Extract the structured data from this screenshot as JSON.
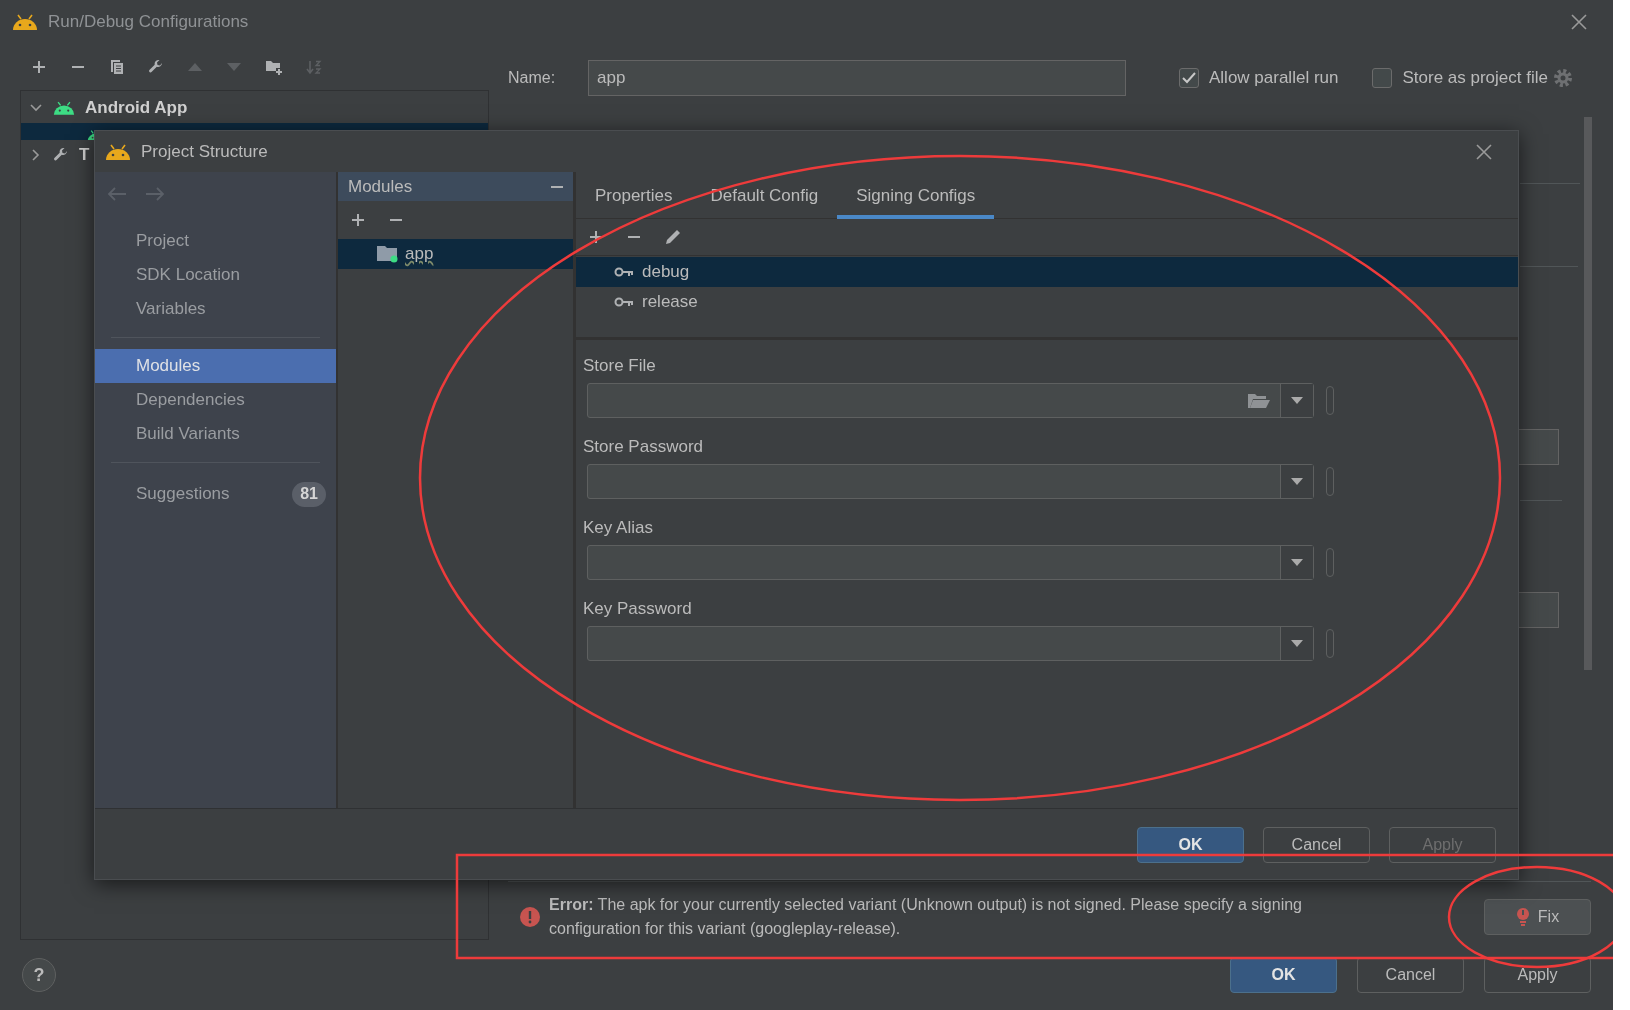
{
  "window": {
    "title": "Run/Debug Configurations"
  },
  "toolbar": [
    {
      "kind": "add",
      "disabled": false
    },
    {
      "kind": "remove",
      "disabled": false
    },
    {
      "kind": "copy",
      "disabled": false
    },
    {
      "kind": "wrench",
      "disabled": false
    },
    {
      "kind": "up",
      "disabled": true
    },
    {
      "kind": "down",
      "disabled": true
    },
    {
      "kind": "folder",
      "disabled": false
    },
    {
      "kind": "sort",
      "disabled": true
    }
  ],
  "tree": [
    {
      "label": "Android App",
      "kind": "android",
      "expanded": true,
      "children": [
        {
          "kind": "android",
          "selected": true
        }
      ]
    },
    {
      "label": "T",
      "kind": "wrench",
      "expanded": false
    }
  ],
  "name_field": {
    "label": "Name:",
    "value": "app"
  },
  "options": [
    {
      "label": "Allow parallel run",
      "checked": true
    },
    {
      "label": "Store as project file",
      "checked": false
    }
  ],
  "dialog": {
    "title": "Project Structure",
    "nav": [
      [
        {
          "label": "Project",
          "selected": false
        },
        {
          "label": "SDK Location",
          "selected": false
        },
        {
          "label": "Variables",
          "selected": false
        }
      ],
      [
        {
          "label": "Modules",
          "selected": true
        },
        {
          "label": "Dependencies",
          "selected": false
        },
        {
          "label": "Build Variants",
          "selected": false
        }
      ],
      [
        {
          "label": "Suggestions",
          "selected": false,
          "badge": "81"
        }
      ]
    ],
    "modules": {
      "header": "Modules",
      "items": [
        {
          "label": "app",
          "selected": true
        }
      ]
    },
    "tabs": [
      {
        "label": "Properties",
        "selected": false
      },
      {
        "label": "Default Config",
        "selected": false
      },
      {
        "label": "Signing Configs",
        "selected": true
      }
    ],
    "configs": [
      {
        "label": "debug",
        "selected": true
      },
      {
        "label": "release",
        "selected": false
      }
    ],
    "fields": [
      {
        "label": "Store File",
        "kind": "file"
      },
      {
        "label": "Store Password",
        "kind": "combo"
      },
      {
        "label": "Key Alias",
        "kind": "combo"
      },
      {
        "label": "Key Password",
        "kind": "combo"
      }
    ],
    "buttons": [
      {
        "label": "OK",
        "kind": "default",
        "disabled": false
      },
      {
        "label": "Cancel",
        "kind": "normal",
        "disabled": false
      },
      {
        "label": "Apply",
        "kind": "normal",
        "disabled": true
      }
    ]
  },
  "error": {
    "text": "**Error:** The apk for your currently selected variant (Unknown output) is not signed. Please specify a signing configuration for this variant (googleplay-release).",
    "button": "Fix"
  },
  "help": "?",
  "buttons": [
    {
      "label": "OK",
      "kind": "default",
      "disabled": false
    },
    {
      "label": "Cancel",
      "kind": "normal",
      "disabled": false
    },
    {
      "label": "Apply",
      "kind": "normal",
      "disabled": false
    }
  ]
}
